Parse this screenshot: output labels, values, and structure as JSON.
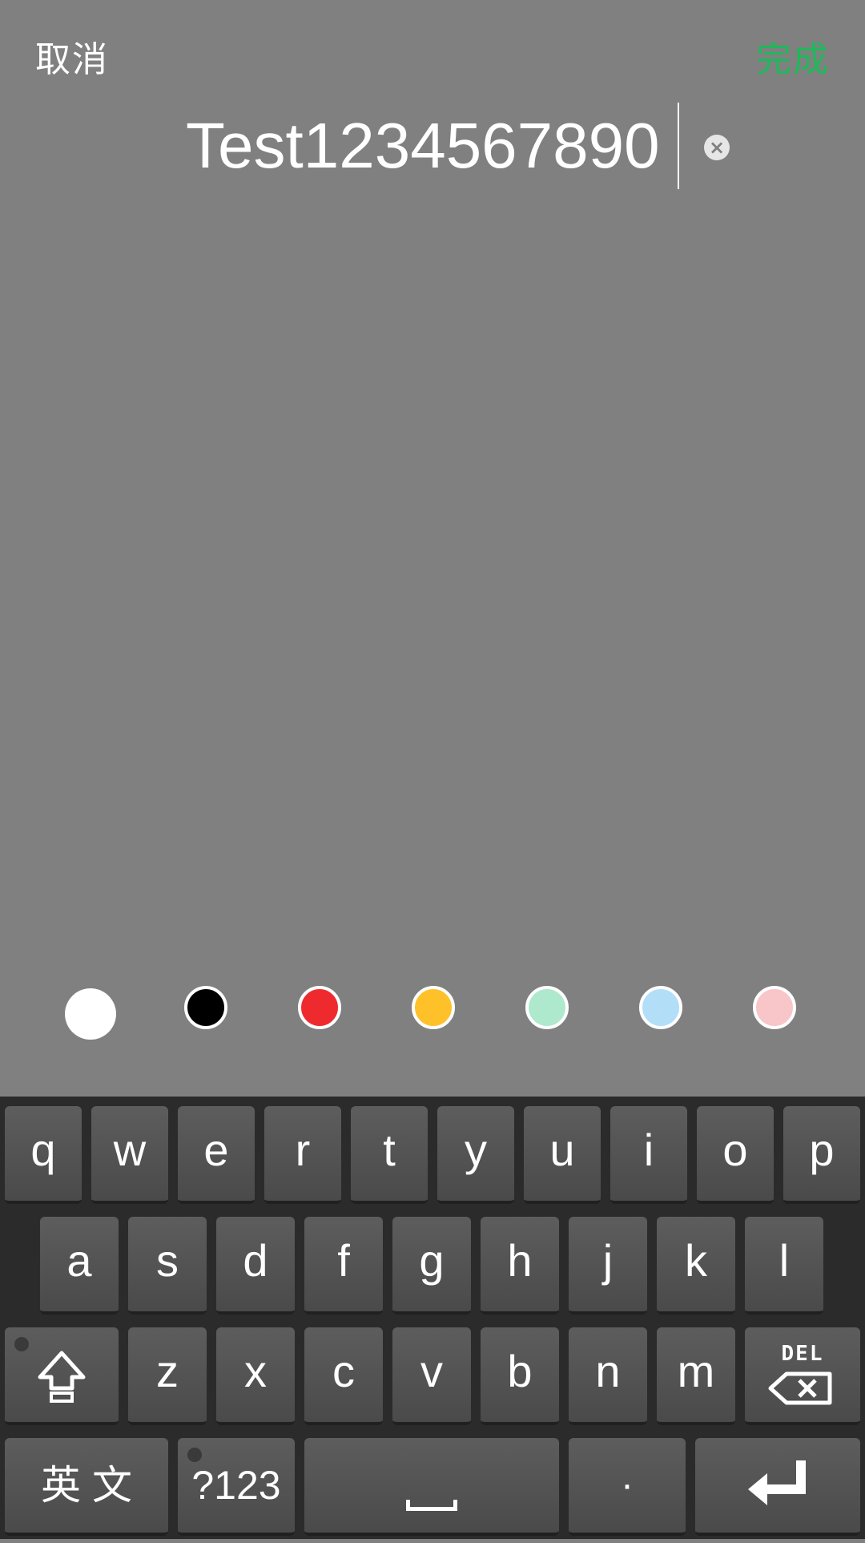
{
  "topbar": {
    "cancel_label": "取消",
    "done_label": "完成"
  },
  "editor": {
    "value": "Test1234567890",
    "clear_icon": "×"
  },
  "colors": {
    "selected": "#ffffff",
    "swatches": [
      "#ffffff",
      "#000000",
      "#ee2a2f",
      "#ffc12a",
      "#aee9cd",
      "#b3def8",
      "#f8c5c9"
    ],
    "accent": "#1fb85a",
    "background": "#808080"
  },
  "keyboard": {
    "row1": [
      "q",
      "w",
      "e",
      "r",
      "t",
      "y",
      "u",
      "i",
      "o",
      "p"
    ],
    "row2": [
      "a",
      "s",
      "d",
      "f",
      "g",
      "h",
      "j",
      "k",
      "l"
    ],
    "row3": [
      "z",
      "x",
      "c",
      "v",
      "b",
      "n",
      "m"
    ],
    "shift_icon": "shift-icon",
    "del_label": "DEL",
    "lang_label": "英 文",
    "sym_label": "?123",
    "period_label": "·",
    "enter_icon": "enter-icon",
    "space_icon": "space-icon"
  }
}
